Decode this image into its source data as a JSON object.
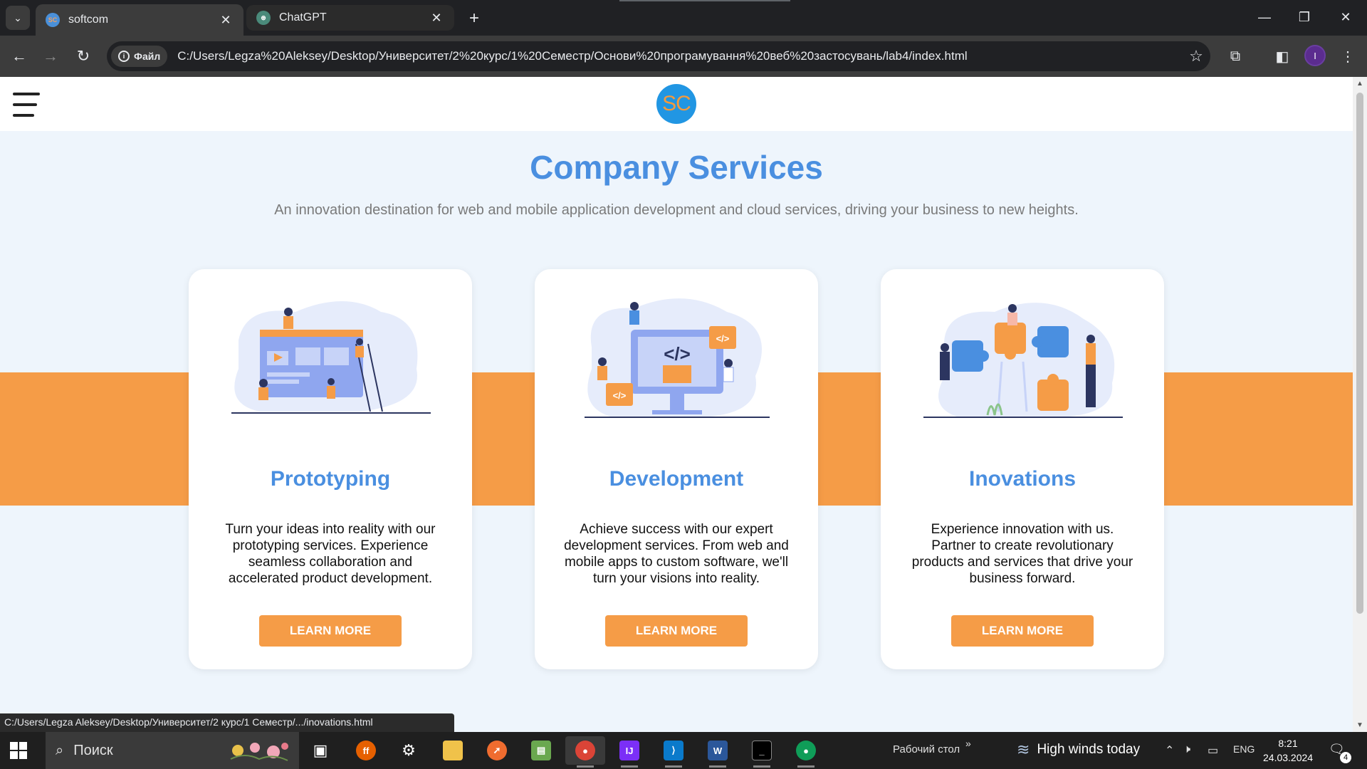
{
  "browser": {
    "tabs": [
      {
        "title": "softcom",
        "favicon": "SC",
        "active": true
      },
      {
        "title": "ChatGPT",
        "favicon": "⊛",
        "active": false
      }
    ],
    "close_glyph": "✕",
    "new_tab_glyph": "+",
    "site_chip": "Файл",
    "url": "C:/Users/Legza%20Aleksey/Desktop/Университет/2%20курс/1%20Семестр/Основи%20програмування%20веб%20застосувань/lab4/index.html",
    "profile_initial": "I",
    "status_url": "C:/Users/Legza Aleksey/Desktop/Университет/2 курс/1 Семестр/.../inovations.html"
  },
  "site": {
    "logo_text": "SC",
    "title": "Company Services",
    "subtitle": "An innovation destination for web and mobile application development and cloud services, driving your business to new heights.",
    "colors": {
      "accent": "#4a8fe0",
      "orange": "#f59c47",
      "page_bg": "#eef5fc"
    },
    "cards": [
      {
        "title": "Prototyping",
        "text": "Turn your ideas into reality with our prototyping services. Experience seamless collaboration and accelerated product development.",
        "button": "LEARN MORE",
        "illustration": "prototyping-illustration"
      },
      {
        "title": "Development",
        "text": "Achieve success with our expert development services. From web and mobile apps to custom software, we'll turn your visions into reality.",
        "button": "LEARN MORE",
        "illustration": "development-illustration"
      },
      {
        "title": "Inovations",
        "text": "Experience innovation with us. Partner to create revolutionary products and services that drive your business forward.",
        "button": "LEARN MORE",
        "illustration": "innovations-illustration"
      }
    ]
  },
  "taskbar": {
    "search_placeholder": "Поиск",
    "desktop_label": "Рабочий стол",
    "weather": "High winds today",
    "language": "ENG",
    "time": "8:21",
    "date": "24.03.2024",
    "notification_count": "4"
  }
}
